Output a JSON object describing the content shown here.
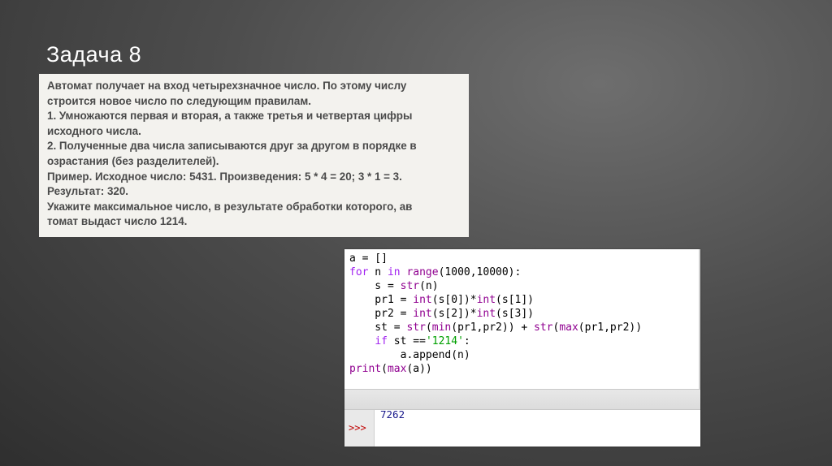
{
  "slide": {
    "title": "Задача  8"
  },
  "task": {
    "lines": [
      "Автомат получает на вход четырехзначное число. По этому числу",
      "строится новое число по следующим правилам.",
      "1. Умножаются первая и вторая, а также третья и четвертая цифры",
      "исходного числа.",
      "2. Полученные два числа записываются друг за другом в порядке в",
      "озрастания (без разделителей).",
      "Пример. Исходное число: 5431. Произведения: 5 * 4 = 20; 3 * 1 = 3.",
      "Результат: 320.",
      "Укажите максимальное число, в результате обработки которого, ав",
      "томат выдаст число 1214."
    ]
  },
  "code": {
    "line1": "a = []",
    "line2_kw1": "for",
    "line2_mid": " n ",
    "line2_kw2": "in",
    "line2_sp": " ",
    "line2_fn": "range",
    "line2_end": "(1000,10000):",
    "line3_ind": "    s = ",
    "line3_fn": "str",
    "line3_end": "(n)",
    "line4_ind": "    pr1 = ",
    "line4_fn1": "int",
    "line4_mid": "(s[0])*",
    "line4_fn2": "int",
    "line4_end": "(s[1])",
    "line5_ind": "    pr2 = ",
    "line5_fn1": "int",
    "line5_mid": "(s[2])*",
    "line5_fn2": "int",
    "line5_end": "(s[3])",
    "line6_ind": "    st = ",
    "line6_fn1": "str",
    "line6_p1": "(",
    "line6_fn2": "min",
    "line6_mid": "(pr1,pr2)) + ",
    "line6_fn3": "str",
    "line6_p2": "(",
    "line6_fn4": "max",
    "line6_end": "(pr1,pr2))",
    "line7_ind": "    ",
    "line7_kw": "if",
    "line7_mid": " st ==",
    "line7_str": "'1214'",
    "line7_end": ":",
    "line8": "        a.append(n)",
    "line9_fn1": "print",
    "line9_p": "(",
    "line9_fn2": "max",
    "line9_end": "(a))"
  },
  "shell": {
    "output": "7262",
    "prompt": ">>>"
  },
  "colors": {
    "keyword": "#a020f0",
    "builtin": "#900090",
    "string": "#00a000",
    "prompt": "#c00000",
    "output": "#1a1a8c"
  }
}
